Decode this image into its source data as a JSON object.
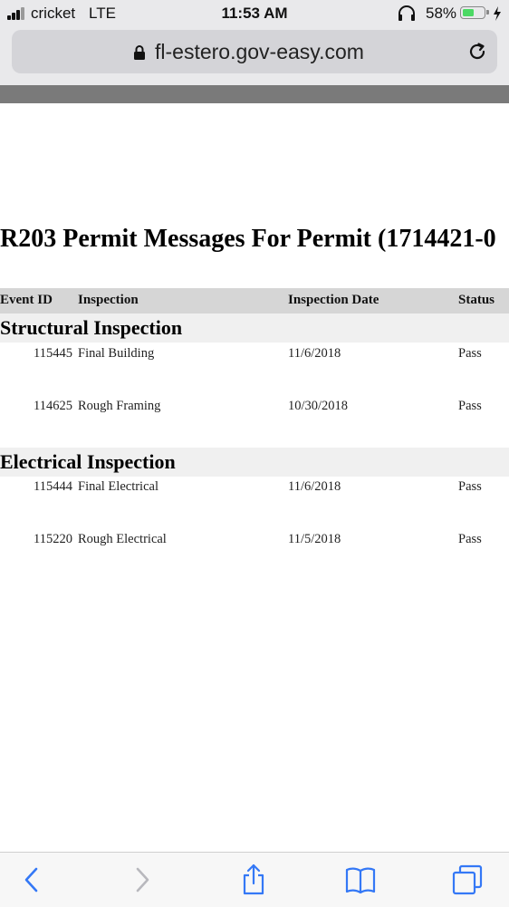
{
  "status_bar": {
    "carrier": "cricket",
    "network": "LTE",
    "time": "11:53 AM",
    "battery_percent": "58%",
    "battery_level": 0.58,
    "battery_color": "#4cd964"
  },
  "address_bar": {
    "url": "fl-estero.gov-easy.com",
    "lock_icon": "lock-icon",
    "reload_icon": "reload-icon"
  },
  "page": {
    "title": "R203 Permit Messages For Permit (1714421-0",
    "columns": [
      "Event ID",
      "Inspection",
      "Inspection Date",
      "Status"
    ],
    "groups": [
      {
        "name": "Structural Inspection",
        "rows": [
          {
            "event_id": "115445",
            "inspection": "Final Building",
            "date": "11/6/2018",
            "status": "Pass"
          },
          {
            "event_id": "114625",
            "inspection": "Rough Framing",
            "date": "10/30/2018",
            "status": "Pass"
          }
        ]
      },
      {
        "name": "Electrical Inspection",
        "rows": [
          {
            "event_id": "115444",
            "inspection": "Final Electrical",
            "date": "11/6/2018",
            "status": "Pass"
          },
          {
            "event_id": "115220",
            "inspection": "Rough Electrical",
            "date": "11/5/2018",
            "status": "Pass"
          }
        ]
      }
    ]
  },
  "toolbar": {
    "icons": [
      "back-icon",
      "forward-icon",
      "share-icon",
      "bookmarks-icon",
      "tabs-icon"
    ],
    "accent_color": "#3478f6",
    "disabled_color": "#b8b8bd"
  }
}
